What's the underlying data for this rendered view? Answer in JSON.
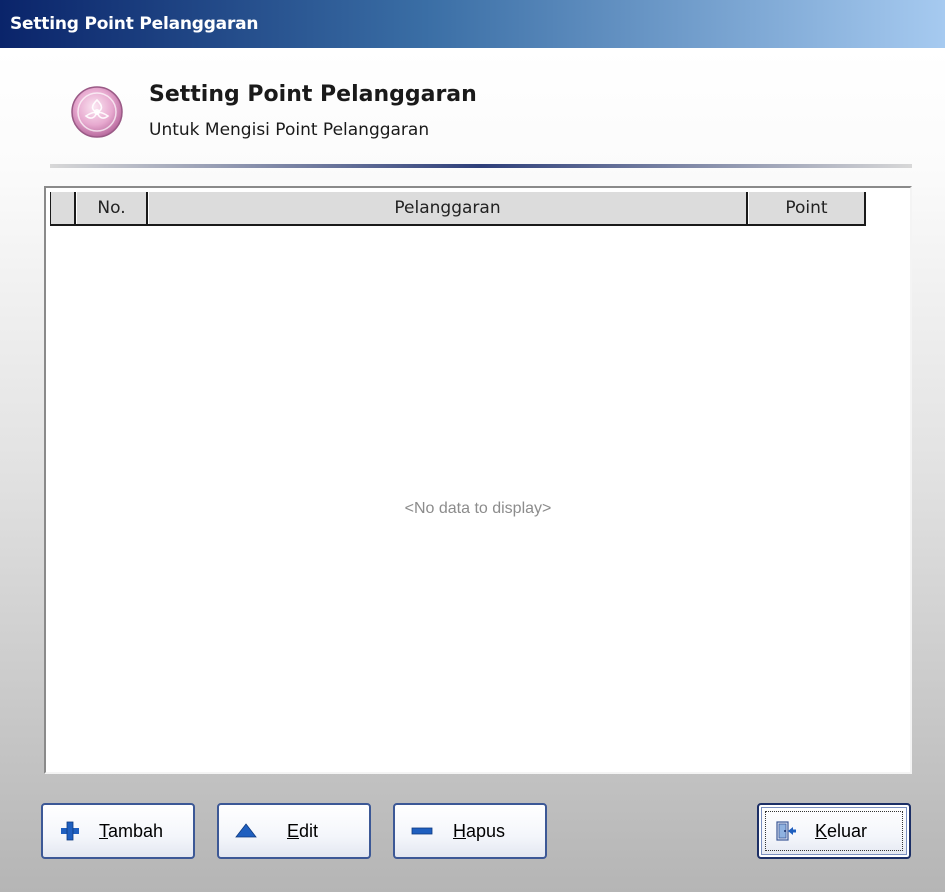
{
  "window": {
    "title": "Setting Point Pelanggaran"
  },
  "header": {
    "icon": "pink-flower-orb-icon",
    "title": "Setting Point Pelanggaran",
    "subtitle": "Untuk Mengisi Point Pelanggaran"
  },
  "grid": {
    "columns": [
      "No.",
      "Pelanggaran",
      "Point"
    ],
    "rows": [],
    "empty_text": "<No data to display>"
  },
  "buttons": {
    "tambah": {
      "mnemonic": "T",
      "rest": "ambah",
      "icon": "plus-icon",
      "icon_color": "#1f5fbf"
    },
    "edit": {
      "mnemonic": "E",
      "rest": "dit",
      "icon": "triangle-up-icon",
      "icon_color": "#1f5fbf"
    },
    "hapus": {
      "mnemonic": "H",
      "rest": "apus",
      "icon": "minus-icon",
      "icon_color": "#1f5fbf"
    },
    "keluar": {
      "mnemonic": "K",
      "rest": "eluar",
      "icon": "exit-door-icon"
    }
  },
  "colors": {
    "titlebar_start": "#0a246a",
    "titlebar_end": "#a6caf0",
    "button_border": "#3c5896"
  }
}
